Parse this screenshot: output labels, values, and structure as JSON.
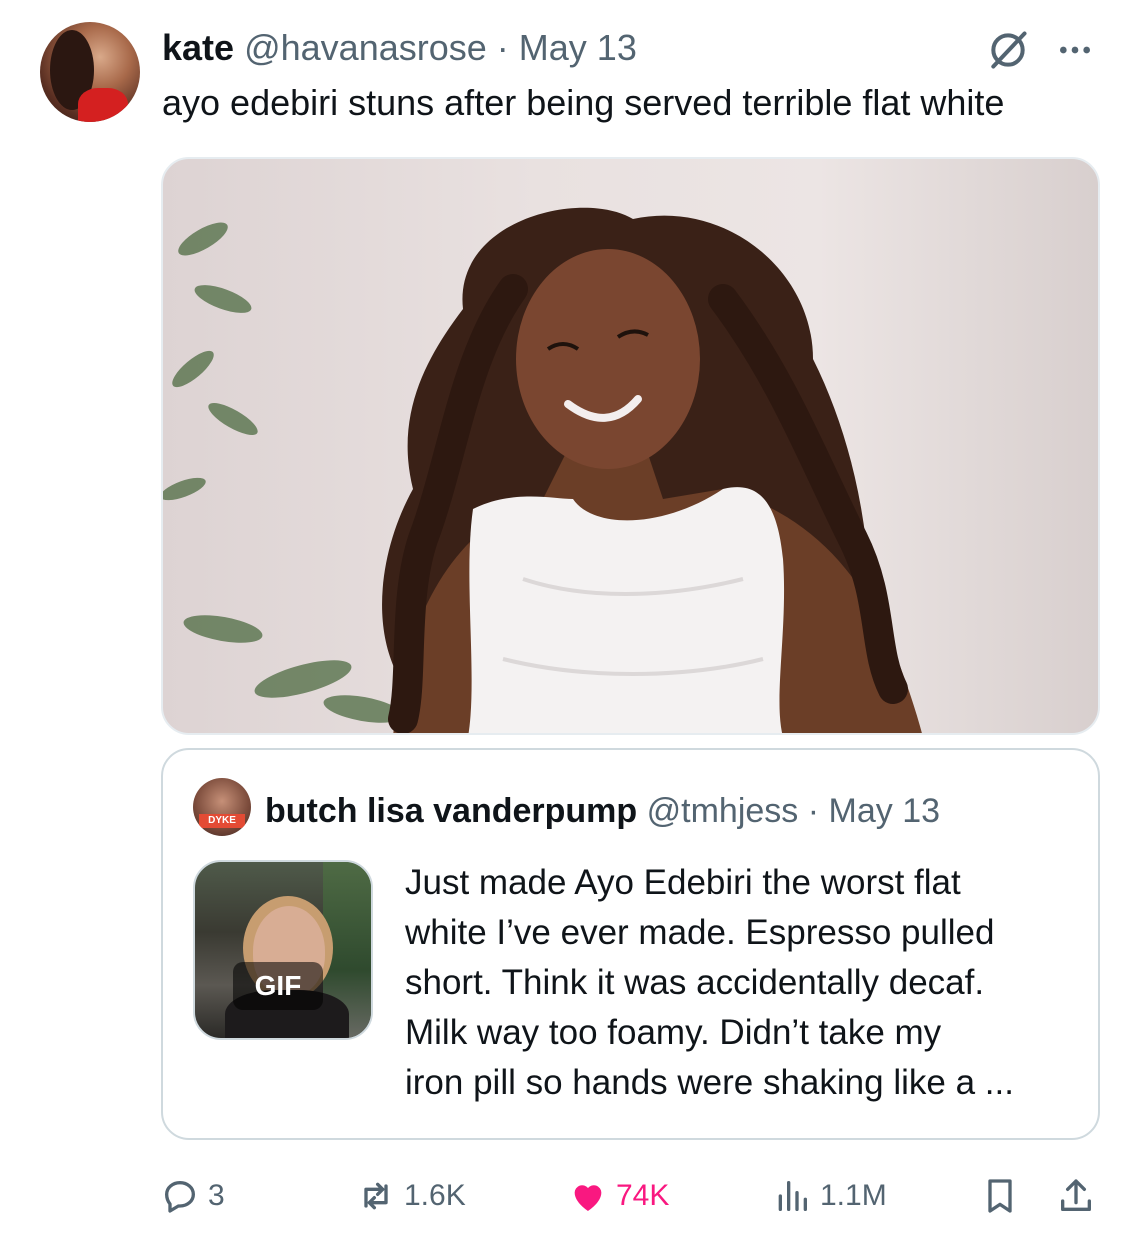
{
  "tweet": {
    "author_name": "kate",
    "author_handle": "@havanasrose",
    "separator": "·",
    "date": "May 13",
    "text": "ayo edebiri stuns after being served terrible flat white",
    "icons": {
      "grok": "grok-icon",
      "more": "more-icon"
    }
  },
  "media": {
    "type": "photo"
  },
  "quote": {
    "author_name": "butch lisa vanderpump",
    "author_handle": "@tmhjess",
    "separator": "·",
    "date": "May 13",
    "gif_label": "GIF",
    "avatar_tag": "DYKE",
    "text_lines": [
      "Just made Ayo Edebiri the worst flat",
      "white I’ve ever made. Espresso pulled",
      "short. Think it was accidentally decaf.",
      "Milk way too foamy. Didn’t take my",
      "iron pill so hands were shaking like a ..."
    ]
  },
  "actions": {
    "replies": "3",
    "reposts": "1.6K",
    "likes": "74K",
    "views": "1.1M",
    "icons": [
      "reply-icon",
      "repost-icon",
      "like-icon",
      "views-icon",
      "bookmark-icon",
      "share-icon"
    ],
    "like_color": "#f91880",
    "muted_color": "#536471"
  }
}
